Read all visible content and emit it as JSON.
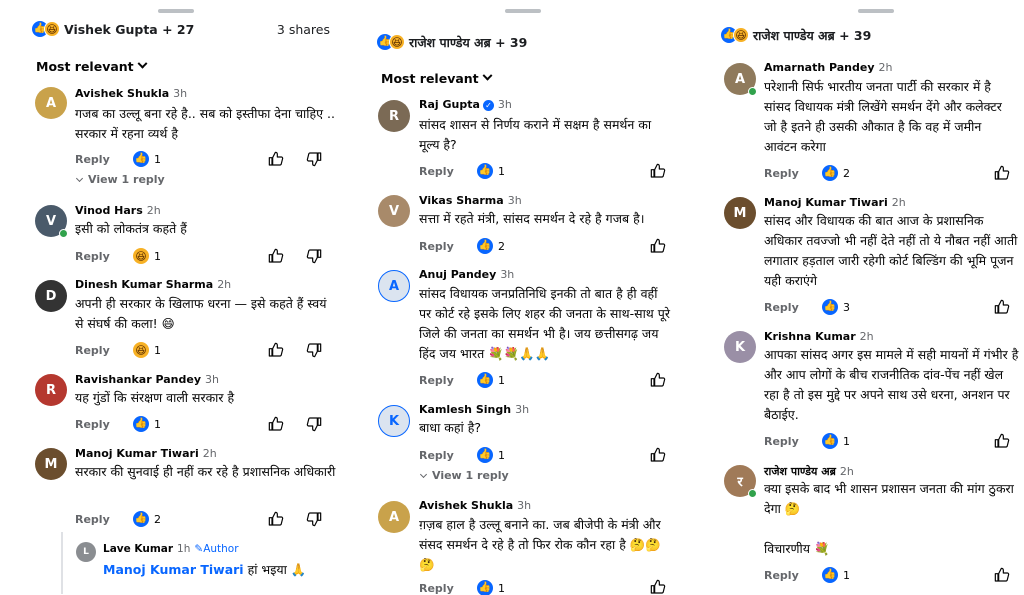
{
  "panel1": {
    "reactions_label": "Vishek Gupta + 27",
    "shares": "3 shares",
    "sort": "Most relevant",
    "comments": [
      {
        "name": "Avishek Shukla",
        "time": "3h",
        "text": "गजब का उल्लू बना रहे है.. सब को इस्तीफा देना चाहिए .. सरकार में रहना व्यर्थ है",
        "reply": "Reply",
        "reaction": "like",
        "count": "1",
        "view_replies": "View 1 reply"
      },
      {
        "name": "Vinod Hars",
        "time": "2h",
        "text": "इसी को लोकतंत्र कहते हैं",
        "reply": "Reply",
        "reaction": "haha",
        "count": "1"
      },
      {
        "name": "Dinesh Kumar Sharma",
        "time": "2h",
        "text": "अपनी ही सरकार के खिलाफ धरना — इसे कहते हैं स्वयं से संघर्ष की कला! 😄",
        "reply": "Reply",
        "reaction": "haha",
        "count": "1"
      },
      {
        "name": "Ravishankar Pandey",
        "time": "3h",
        "text": "यह गुंडों कि संरक्षण वाली सरकार है",
        "reply": "Reply",
        "reaction": "like",
        "count": "1"
      },
      {
        "name": "Manoj Kumar Tiwari",
        "time": "2h",
        "text": "सरकार की सुनवाई ही नहीं कर रहे है प्रशासनिक अधिकारी",
        "reply": "Reply",
        "reaction": "like",
        "count": "2"
      }
    ],
    "nested_reply": {
      "name": "Lave Kumar",
      "time": "1h",
      "badge": "Author",
      "mention": "Manoj Kumar Tiwari",
      "text": "हां भइया 🙏"
    }
  },
  "panel2": {
    "reactions_label": "राजेश पाण्डेय अब्र + 39",
    "sort": "Most relevant",
    "comments": [
      {
        "name": "Raj Gupta",
        "time": "3h",
        "text": "सांसद शासन से निर्णय कराने में सक्षम है समर्थन का मूल्य है?",
        "reply": "Reply",
        "reaction": "like",
        "count": "1"
      },
      {
        "name": "Vikas Sharma",
        "time": "3h",
        "text": "सत्ता में रहते मंत्री, सांसद समर्थन दे रहे है गजब है।",
        "reply": "Reply",
        "reaction": "like",
        "count": "2"
      },
      {
        "name": "Anuj Pandey",
        "time": "3h",
        "text": "सांसद विधायक जनप्रतिनिधि इनकी तो बात है ही वहीं पर कोर्ट रहे इसके लिए शहर की जनता के साथ-साथ पूरे जिले की जनता का समर्थन भी है। जय छत्तीसगढ़ जय हिंद जय भारत 💐💐🙏🙏",
        "reply": "Reply",
        "reaction": "like",
        "count": "1"
      },
      {
        "name": "Kamlesh Singh",
        "time": "3h",
        "text": "बाधा कहां है?",
        "reply": "Reply",
        "reaction": "like",
        "count": "1",
        "view_replies": "View 1 reply"
      },
      {
        "name": "Avishek Shukla",
        "time": "3h",
        "text": "ग़ज़ब हाल है उल्लू बनाने का. जब बीजेपी के मंत्री और संसद समर्थन दे रहे है तो फिर रोक कौन रहा है 🤔🤔🤔",
        "reply": "Reply",
        "reaction": "like",
        "count": "1"
      }
    ]
  },
  "panel3": {
    "reactions_label": "राजेश पाण्डेय अब्र + 39",
    "comments": [
      {
        "name": "Amarnath Pandey",
        "time": "2h",
        "text": "परेशानी सिर्फ भारतीय जनता पार्टी की सरकार में है सांसद विधायक मंत्री लिखेंगे समर्थन देंगे और कलेक्टर जो है इतने ही उसकी औकात है कि वह में जमीन आवंटन करेगा",
        "reply": "Reply",
        "reaction": "like",
        "count": "2"
      },
      {
        "name": "Manoj Kumar Tiwari",
        "time": "2h",
        "text": "सांसद और विधायक की बात आज के प्रशासनिक अधिकार तवज्जो भी नहीं देते नहीं तो ये नौबत नहीं आती लगातार हड़ताल जारी रहेगी  कोर्ट बिल्डिंग की भूमि पूजन यही कराएंगे",
        "reply": "Reply",
        "reaction": "like",
        "count": "3"
      },
      {
        "name": "Krishna Kumar",
        "time": "2h",
        "text": "आपका सांसद अगर इस मामले में सही मायनों में गंभीर है और आप लोगों के बीच राजनीतिक दांव-पेंच नहीं खेल रहा है तो इस मुद्दे पर अपने साथ उसे धरना, अनशन पर बैठाईए.",
        "reply": "Reply",
        "reaction": "like",
        "count": "1"
      },
      {
        "name": "राजेश पाण्डेय अब्र",
        "time": "2h",
        "text": "क्या इसके बाद भी शासन प्रशासन जनता की मांग ठुकरा देगा 🤔",
        "text2": "विचारणीय 💐",
        "reply": "Reply",
        "reaction": "like",
        "count": "1"
      }
    ]
  },
  "colors": {
    "accent": "#0866ff",
    "haha": "#f7b125",
    "muted": "#65676b",
    "online": "#31a24c"
  },
  "icons": {
    "like": "like-icon",
    "haha": "haha-icon",
    "thumb_up": "thumb-up-icon",
    "thumb_down": "thumb-down-icon",
    "chevron": "chevron-down-icon"
  }
}
